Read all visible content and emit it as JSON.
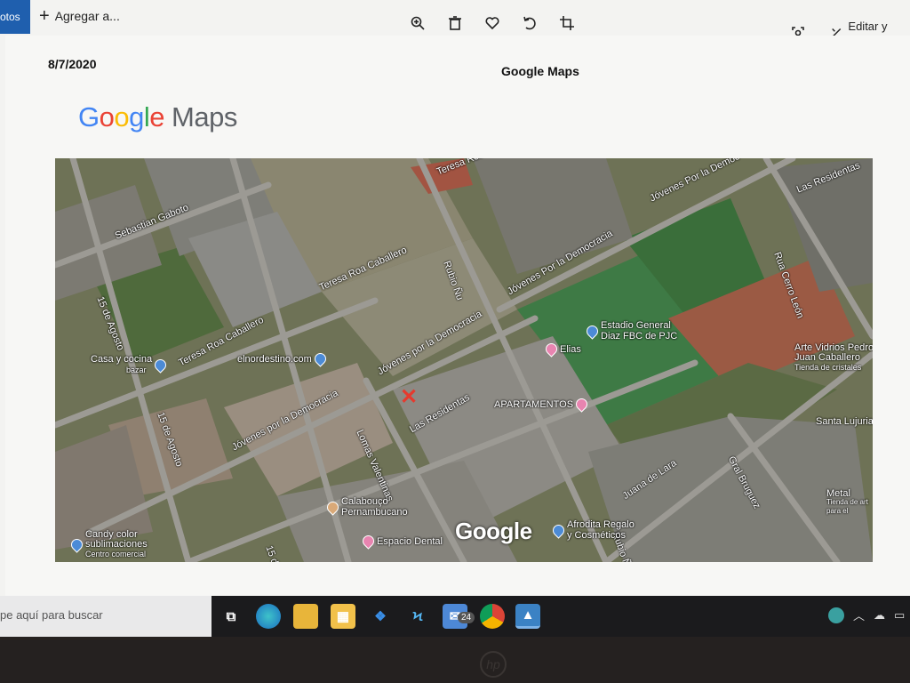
{
  "app": {
    "tab_label": "otos",
    "add_to_label": "Agregar a...",
    "edit_create_label": "Editar y crear",
    "toolbar_icons": [
      "zoom-in-icon",
      "delete-icon",
      "heart-icon",
      "rotate-icon",
      "crop-icon"
    ]
  },
  "document": {
    "date": "8/7/2020",
    "title": "Google Maps",
    "logo": {
      "google": "Google",
      "maps": "Maps"
    }
  },
  "map": {
    "watermark": "Google",
    "streets": [
      "Teresa Roa Caballero",
      "Teresa Roa Caballero",
      "Teresa Roa Caballero",
      "Sebastian Gaboto",
      "15 de Agosto",
      "15 de Agosto",
      "15 de Agosto",
      "Jóvenes por la Democracia",
      "Jóvenes por la Democracia",
      "Jóvenes Por la Democracia",
      "Jóvenes Por la Democ",
      "Rubio Ñu",
      "Las Residentas",
      "Las Residentas",
      "Lomas Valentinas",
      "Rua Cerro León",
      "Gral Bruguez",
      "Juana de Lara",
      "Rubio Ñ"
    ],
    "pois": [
      {
        "name": "Casa y cocina",
        "sub": "bazar",
        "pin": "blue"
      },
      {
        "name": "elnordestino.com",
        "sub": "",
        "pin": "blue"
      },
      {
        "name": "Estadio General Diaz FBC de PJC",
        "sub": "",
        "pin": "blue"
      },
      {
        "name": "Elias",
        "sub": "",
        "pin": "pink"
      },
      {
        "name": "APARTAMENTOS",
        "sub": "",
        "pin": "pink"
      },
      {
        "name": "Arte Vidrios Pedro Juan Caballero",
        "sub": "Tienda de cristales",
        "pin": "blue"
      },
      {
        "name": "Santa Lujuria",
        "sub": "",
        "pin": "blue"
      },
      {
        "name": "Calabouço Pernambucano",
        "sub": "",
        "pin": "tan"
      },
      {
        "name": "Espacio Dental",
        "sub": "",
        "pin": "pink"
      },
      {
        "name": "Candy color sublimaciones",
        "sub": "Centro comercial",
        "pin": "blue"
      },
      {
        "name": "Afrodita Regalo y Cosméticos",
        "sub": "",
        "pin": "blue"
      },
      {
        "name": "Metal",
        "sub": "Tienda de art para el",
        "pin": "blue"
      }
    ]
  },
  "taskbar": {
    "search_placeholder": "pe aquí para buscar",
    "mail_badge": "24",
    "apps": [
      "task-view-icon",
      "edge-icon",
      "file-explorer-icon",
      "store-icon",
      "dropbox-icon",
      "app-s-icon",
      "mail-icon",
      "chrome-icon",
      "photos-icon"
    ]
  }
}
